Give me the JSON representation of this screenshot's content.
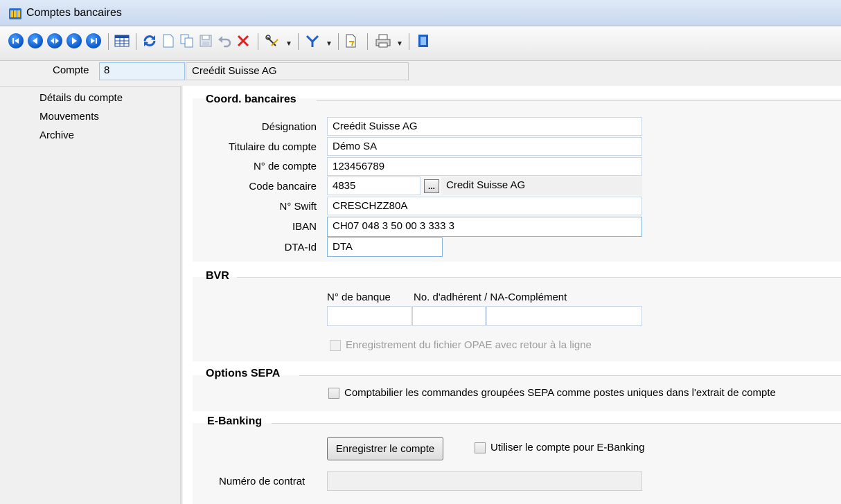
{
  "window": {
    "title": "Comptes bancaires"
  },
  "header": {
    "compte_label": "Compte",
    "compte_value": "8",
    "compte_name": "Creédit Suisse AG"
  },
  "sidebar": {
    "items": [
      {
        "label": "Détails du compte"
      },
      {
        "label": "Mouvements"
      },
      {
        "label": "Archive"
      }
    ]
  },
  "coord": {
    "title": "Coord. bancaires",
    "designation_label": "Désignation",
    "designation_value": "Creédit Suisse AG",
    "titulaire_label": "Titulaire du compte",
    "titulaire_value": "Démo SA",
    "numero_label": "N° de compte",
    "numero_value": "123456789",
    "code_label": "Code bancaire",
    "code_value": "4835",
    "code_button": "...",
    "bank_name": "Credit Suisse AG",
    "swift_label": "N° Swift",
    "swift_value": "CRESCHZZ80A",
    "iban_label": "IBAN",
    "iban_value": "CH07  048 3 50 00 3 333  3",
    "dta_label": "DTA-Id",
    "dta_value": "DTA"
  },
  "bvr": {
    "title": "BVR",
    "col_banque": "N° de banque",
    "col_adherent": "No. d'adhérent / NA-Complément",
    "banque_value": "",
    "adherent_value": "",
    "complement_value": "",
    "opae_label": "Enregistrement du fichier OPAE avec retour à la ligne"
  },
  "sepa": {
    "title": "Options SEPA",
    "option_label": "Comptabilier les commandes groupées SEPA comme postes uniques dans l'extrait de compte"
  },
  "ebanking": {
    "title": "E-Banking",
    "register_button": "Enregistrer le compte",
    "use_label": "Utiliser le compte pour E-Banking",
    "contrat_label": "Numéro de contrat",
    "contrat_value": ""
  },
  "toolbar": {
    "icons": [
      "first-record-icon",
      "previous-record-icon",
      "stop-icon",
      "next-record-icon",
      "last-record-icon",
      "table-view-icon",
      "refresh-icon",
      "new-document-icon",
      "copy-icon",
      "save-icon",
      "undo-icon",
      "delete-icon",
      "tools-icon",
      "filter-icon",
      "report-icon",
      "print-icon",
      "exit-icon"
    ]
  }
}
